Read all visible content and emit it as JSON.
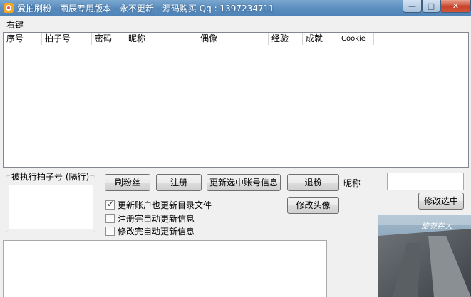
{
  "window": {
    "title": "爱拍刷粉 - 雨辰专用版本 - 永不更新 - 源码购买 Qq : 1397234711",
    "minimize_glyph": "—",
    "maximize_glyph": "□",
    "close_glyph": "✕"
  },
  "menu": {
    "items": [
      {
        "label": "右键"
      }
    ]
  },
  "table": {
    "columns": [
      "序号",
      "拍子号",
      "密码",
      "昵称",
      "偶像",
      "经验",
      "成就",
      "Cookie"
    ],
    "rows": []
  },
  "target_group": {
    "legend": "被执行拍子号 (隔行)",
    "value": ""
  },
  "buttons": {
    "brush_fans": "刷粉丝",
    "register": "注册",
    "update_selected": "更新选中账号信息",
    "unfollow": "退粉",
    "change_avatar": "修改头像",
    "modify_selected": "修改选中"
  },
  "nickname": {
    "label": "昵称",
    "value": ""
  },
  "options": [
    {
      "label": "更新账户也更新目录文件",
      "checked": true
    },
    {
      "label": "注册完自动更新信息",
      "checked": false
    },
    {
      "label": "修改完自动更新信息",
      "checked": false
    }
  ],
  "log": {
    "value": ""
  },
  "photo": {
    "caption": "旅尧在大"
  },
  "colors": {
    "title_bar": "#5d8fc0",
    "close_button": "#c7432a",
    "window_bg": "#f0f0f0"
  }
}
